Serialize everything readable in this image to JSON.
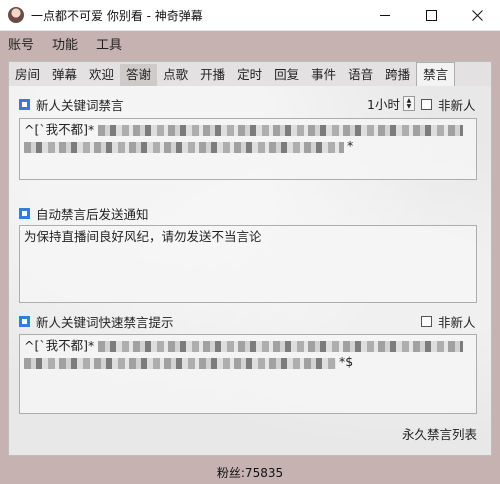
{
  "window": {
    "title": "一点都不可爱 你别看 - 神奇弹幕"
  },
  "menu": [
    "账号",
    "功能",
    "工具"
  ],
  "tabs": [
    "房间",
    "弹幕",
    "欢迎",
    "答谢",
    "点歌",
    "开播",
    "定时",
    "回复",
    "事件",
    "语音",
    "跨播",
    "禁言"
  ],
  "active_tab": "禁言",
  "section1": {
    "label": "新人关键词禁言",
    "checked": true,
    "duration_value": "1小时",
    "non_new_label": "非新人",
    "non_new_checked": false,
    "keywords_text": "^[`我不都]*",
    "keywords_tail": "*"
  },
  "section2": {
    "label": "自动禁言后发送通知",
    "checked": true,
    "notice_text": "为保持直播间良好风纪，请勿发送不当言论"
  },
  "section3": {
    "label": "新人关键词快速禁言提示",
    "checked": true,
    "non_new_label": "非新人",
    "non_new_checked": false,
    "keywords_text": "^[`我不都]*",
    "keywords_tail": "*$"
  },
  "permanent_ban_link": "永久禁言列表",
  "status": {
    "fans": "粉丝:75835"
  }
}
